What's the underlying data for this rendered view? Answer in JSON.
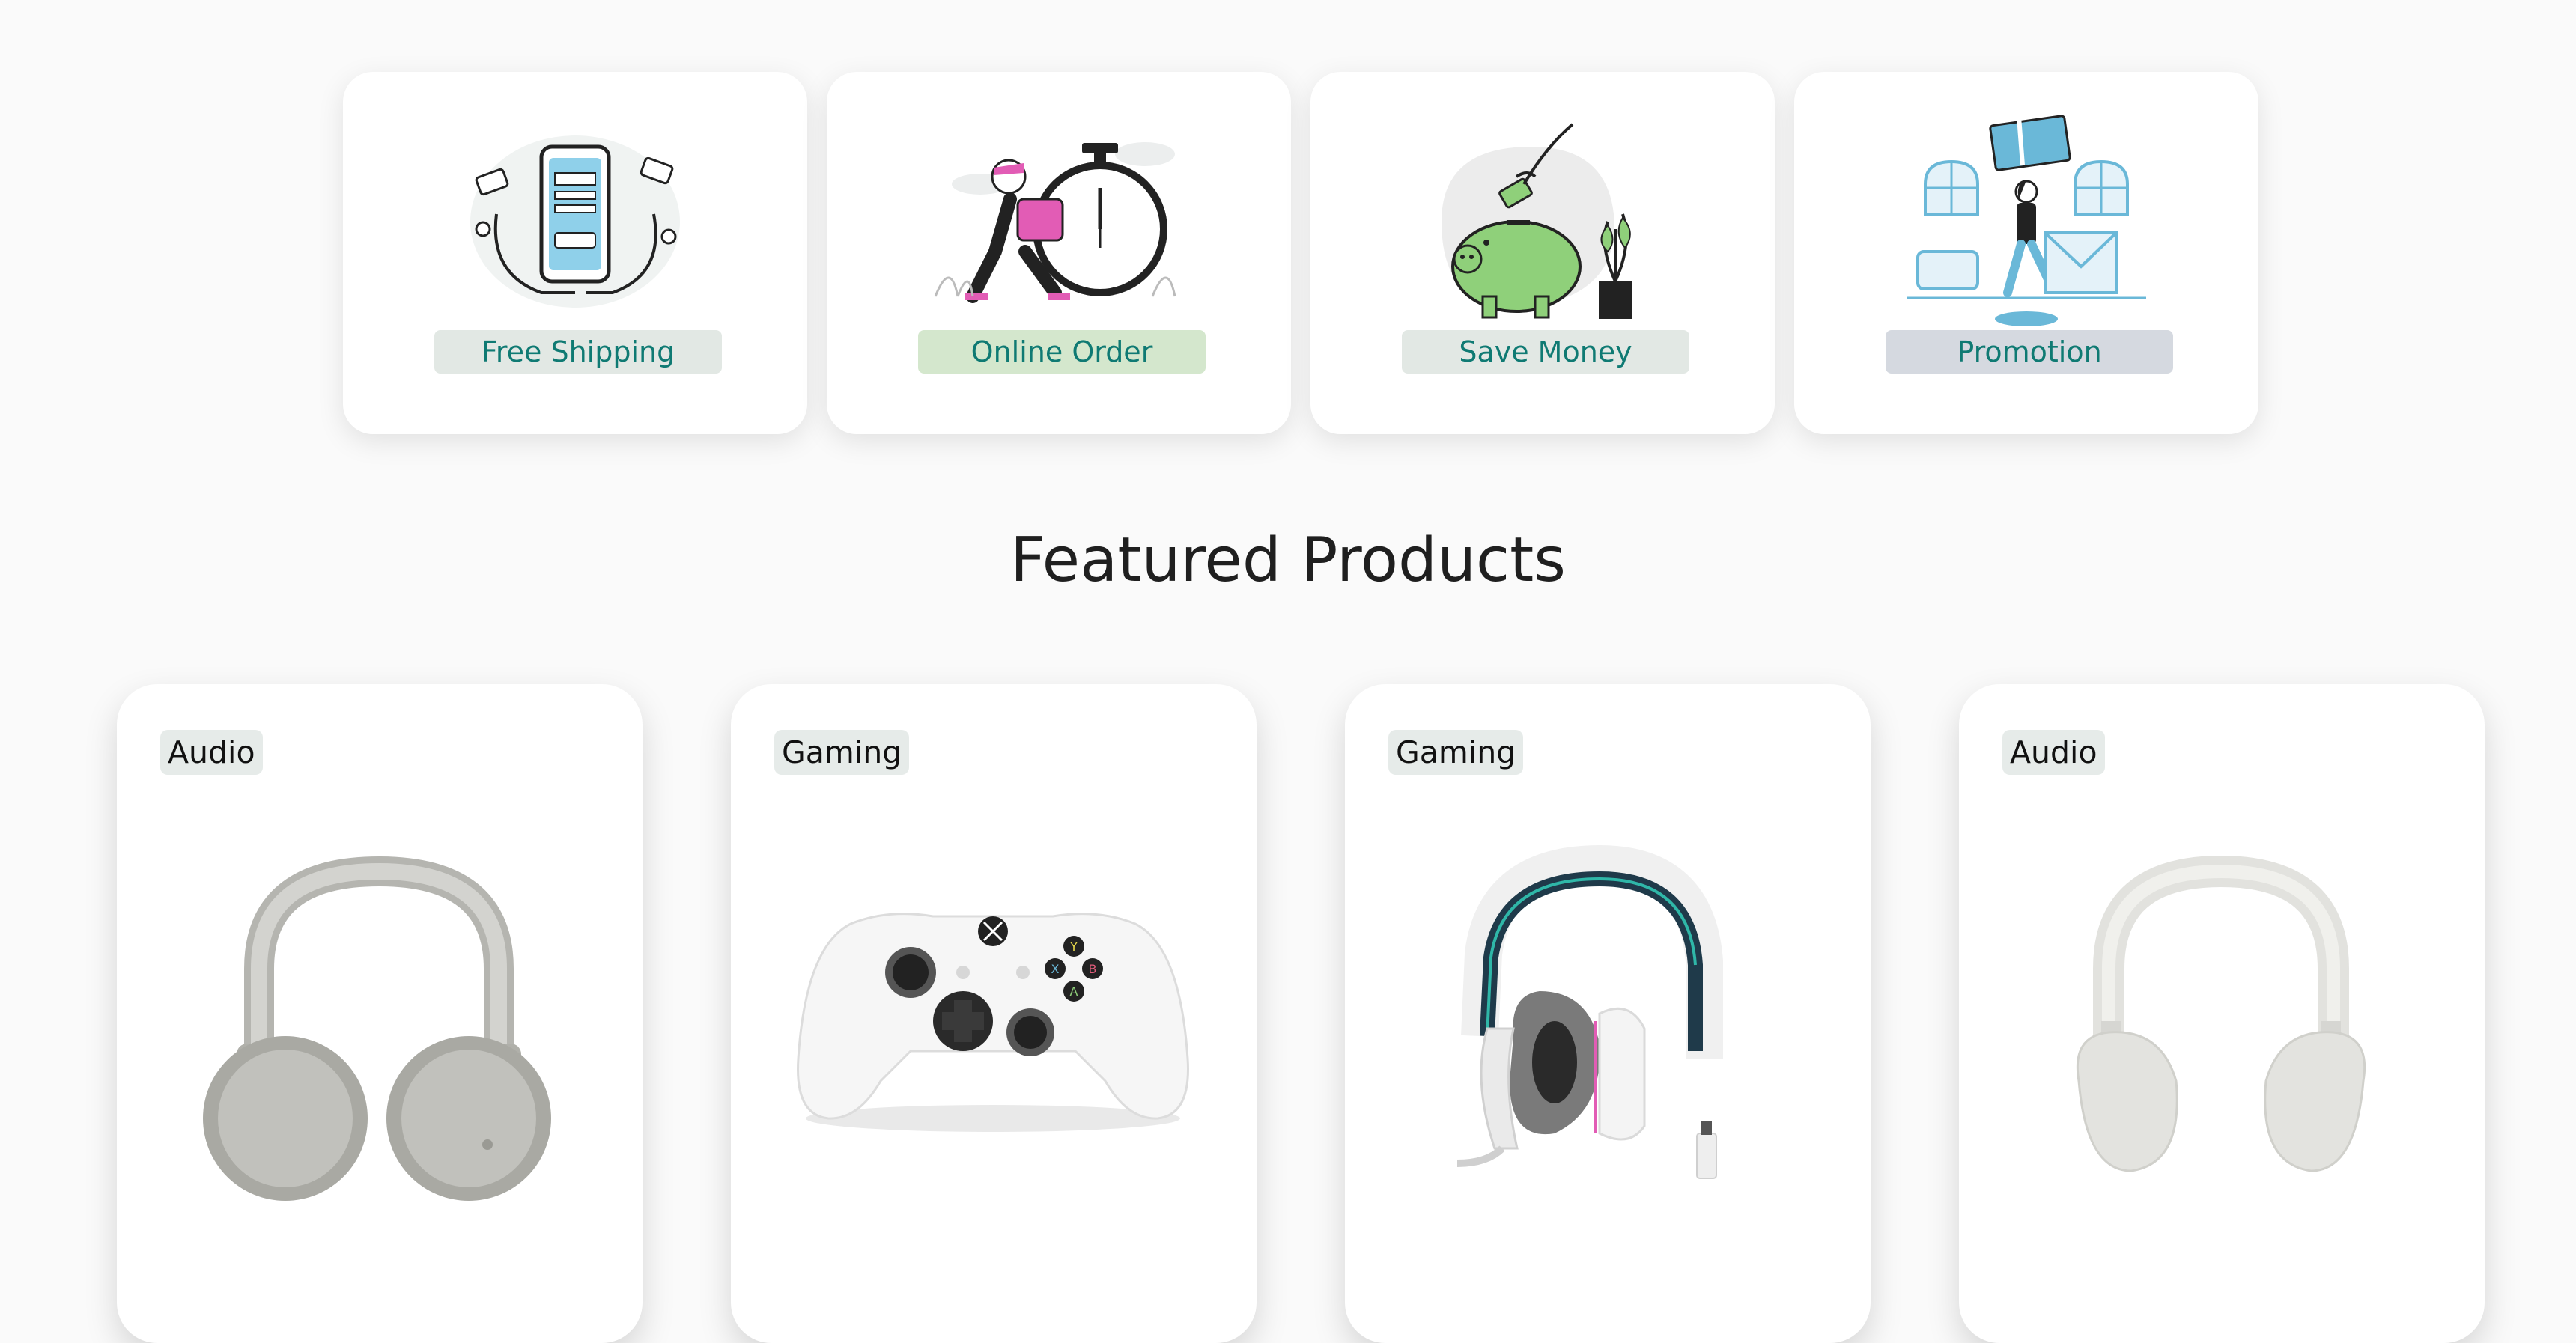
{
  "features": [
    {
      "label": "Free Shipping",
      "bg": "#e2e8e4",
      "icon": "mobile-payment-illustration-icon"
    },
    {
      "label": "Online Order",
      "bg": "#d4e7cd",
      "icon": "delivery-clock-illustration-icon"
    },
    {
      "label": "Save Money",
      "bg": "#e2e8e4",
      "icon": "piggy-bank-illustration-icon"
    },
    {
      "label": "Promotion",
      "bg": "#d5d9e0",
      "icon": "gift-promotion-illustration-icon"
    }
  ],
  "section": {
    "title": "Featured Products"
  },
  "products": [
    {
      "category": "Audio",
      "image": "silver-over-ear-headphones-icon"
    },
    {
      "category": "Gaming",
      "image": "white-game-controller-icon"
    },
    {
      "category": "Gaming",
      "image": "white-gaming-headset-icon"
    },
    {
      "category": "Audio",
      "image": "white-wireless-headphones-icon"
    }
  ],
  "colors": {
    "accent": "#0f7a73",
    "illustration_green": "#8fd07a",
    "illustration_pink": "#e25cb5",
    "illustration_blue": "#6ab8d8"
  }
}
